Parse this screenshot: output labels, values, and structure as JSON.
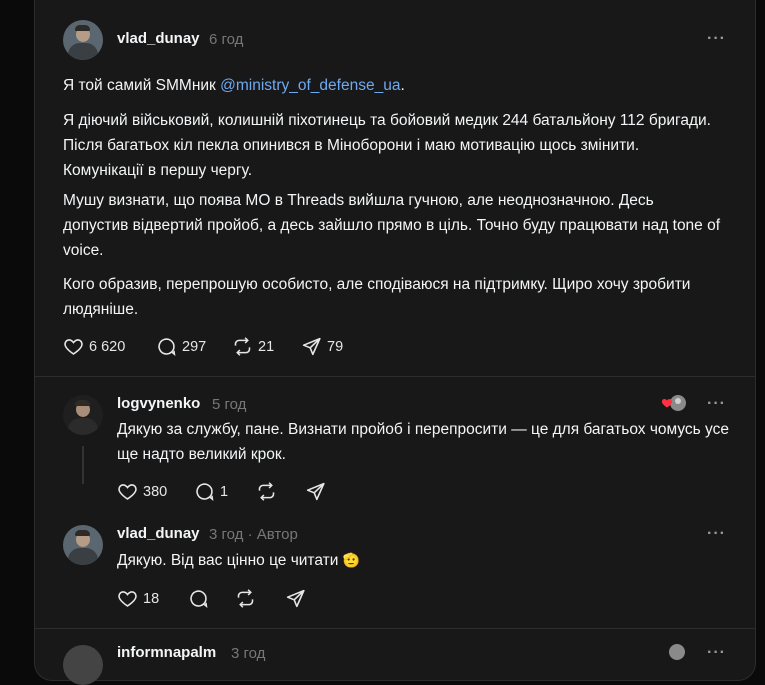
{
  "post": {
    "username": "vlad_dunay",
    "time": "6 год",
    "para1_prefix": "Я той самий SMMник ",
    "para1_mention": "@ministry_of_defense_ua",
    "para1_suffix": ".",
    "para2": "Я діючий військовий, колишній піхотинець та бойовий медик 244 батальйону 112 бригади. Після багатьох кіл пекла опинився в Міноборони і маю мотивацію щось змінити. Комунікації в першу чергу.",
    "para3": "Мушу визнати, що поява МО в Threads вийшла гучною, але неоднозначною. Десь допустив відвертий пройоб, а десь зайшло прямо в ціль. Точно буду працювати над tone of voice.",
    "para4": "Кого образив, перепрошую особисто, але сподіваюся на підтримку. Щиро хочу зробити людяніше.",
    "likes": "6 620",
    "comments": "297",
    "reposts": "21",
    "shares": "79"
  },
  "reply1": {
    "username": "logvynenko",
    "time": "5 год",
    "text": "Дякую за службу, пане. Визнати пройоб і перепросити — це для багатьох чомусь усе ще надто великий крок.",
    "likes": "380",
    "comments": "1"
  },
  "reply2": {
    "username": "vlad_dunay",
    "time": "3 год",
    "dot": "·",
    "author_badge": "Автор",
    "text": "Дякую. Від вас цінно це читати",
    "emoji": "🫡",
    "likes": "18"
  },
  "reply3": {
    "username": "informnapalm",
    "time": "3 год"
  },
  "more_label": "···",
  "icons": {
    "like": "heart-icon",
    "comment": "comment-icon",
    "repost": "repost-icon",
    "share": "share-icon",
    "more": "more-icon"
  }
}
